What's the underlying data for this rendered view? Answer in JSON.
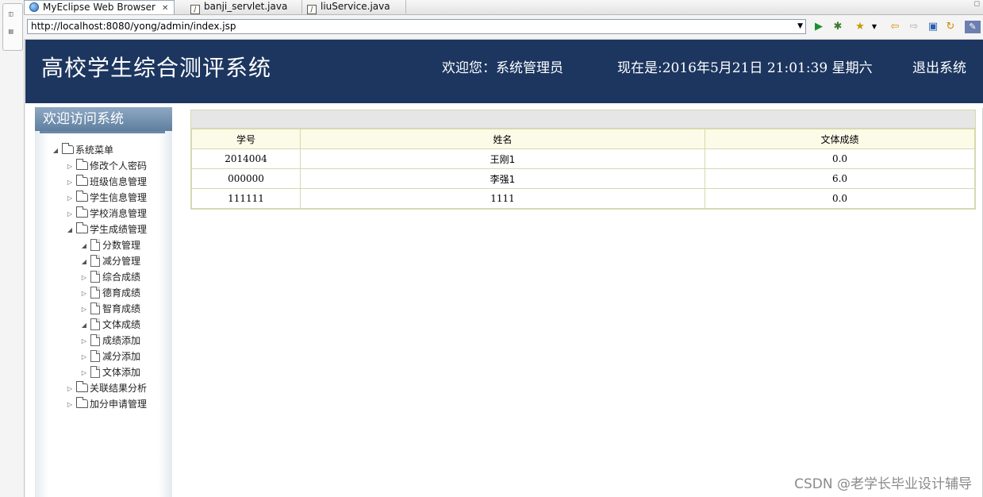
{
  "ide": {
    "tabs": [
      {
        "label": "MyEclipse Web Browser",
        "icon": "globe-icon",
        "active": true
      },
      {
        "label": "banji_servlet.java",
        "icon": "java-file-icon",
        "active": false
      },
      {
        "label": "liuService.java",
        "icon": "java-file-icon",
        "active": false
      }
    ]
  },
  "browser": {
    "url": "http://localhost:8080/yong/admin/index.jsp"
  },
  "header": {
    "title": "高校学生综合测评系统",
    "welcome": "欢迎您：系统管理员",
    "clock": "现在是:2016年5月21日  21:01:39 星期六",
    "logout": "退出系统"
  },
  "menu": {
    "heading": "欢迎访问系统",
    "root": "系统菜单",
    "items": [
      {
        "label": "修改个人密码"
      },
      {
        "label": "班级信息管理"
      },
      {
        "label": "学生信息管理"
      },
      {
        "label": "学校消息管理"
      },
      {
        "label": "学生成绩管理",
        "expanded": true
      },
      {
        "label": "分数管理",
        "child": true,
        "expanded": true
      },
      {
        "label": "减分管理",
        "child": true,
        "expanded": true
      },
      {
        "label": "综合成绩",
        "child": true
      },
      {
        "label": "德育成绩",
        "child": true
      },
      {
        "label": "智育成绩",
        "child": true
      },
      {
        "label": "文体成绩",
        "child": true,
        "expanded": true
      },
      {
        "label": "成绩添加",
        "child": true
      },
      {
        "label": "减分添加",
        "child": true
      },
      {
        "label": "文体添加",
        "child": true
      },
      {
        "label": "关联结果分析"
      },
      {
        "label": "加分申请管理"
      }
    ]
  },
  "table": {
    "columns": [
      "学号",
      "姓名",
      "文体成绩"
    ],
    "rows": [
      [
        "2014004",
        "王刚1",
        "0.0"
      ],
      [
        "000000",
        "李强1",
        "6.0"
      ],
      [
        "111111",
        "1111",
        "0.0"
      ]
    ]
  },
  "watermark": "CSDN @老学长毕业设计辅导"
}
